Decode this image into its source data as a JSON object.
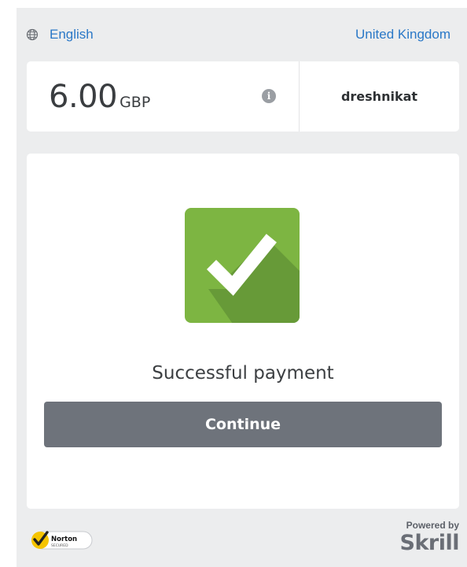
{
  "header": {
    "language_icon": "globe-icon",
    "language": "English",
    "country": "United Kingdom"
  },
  "amount_card": {
    "amount": "6.00",
    "currency": "GBP",
    "info_icon": "info-icon",
    "merchant": "dreshnikat"
  },
  "result": {
    "icon": "checkmark-icon",
    "status": "Successful payment",
    "continue_label": "Continue"
  },
  "footer": {
    "norton_badge_text": "Norton",
    "norton_badge_subtext": "SECURED",
    "powered_by": "Powered by",
    "brand": "Skrill"
  },
  "colors": {
    "link": "#2a78c7",
    "success_green": "#7db542",
    "button_gray": "#6e737b",
    "panel_bg": "#ecedee"
  }
}
